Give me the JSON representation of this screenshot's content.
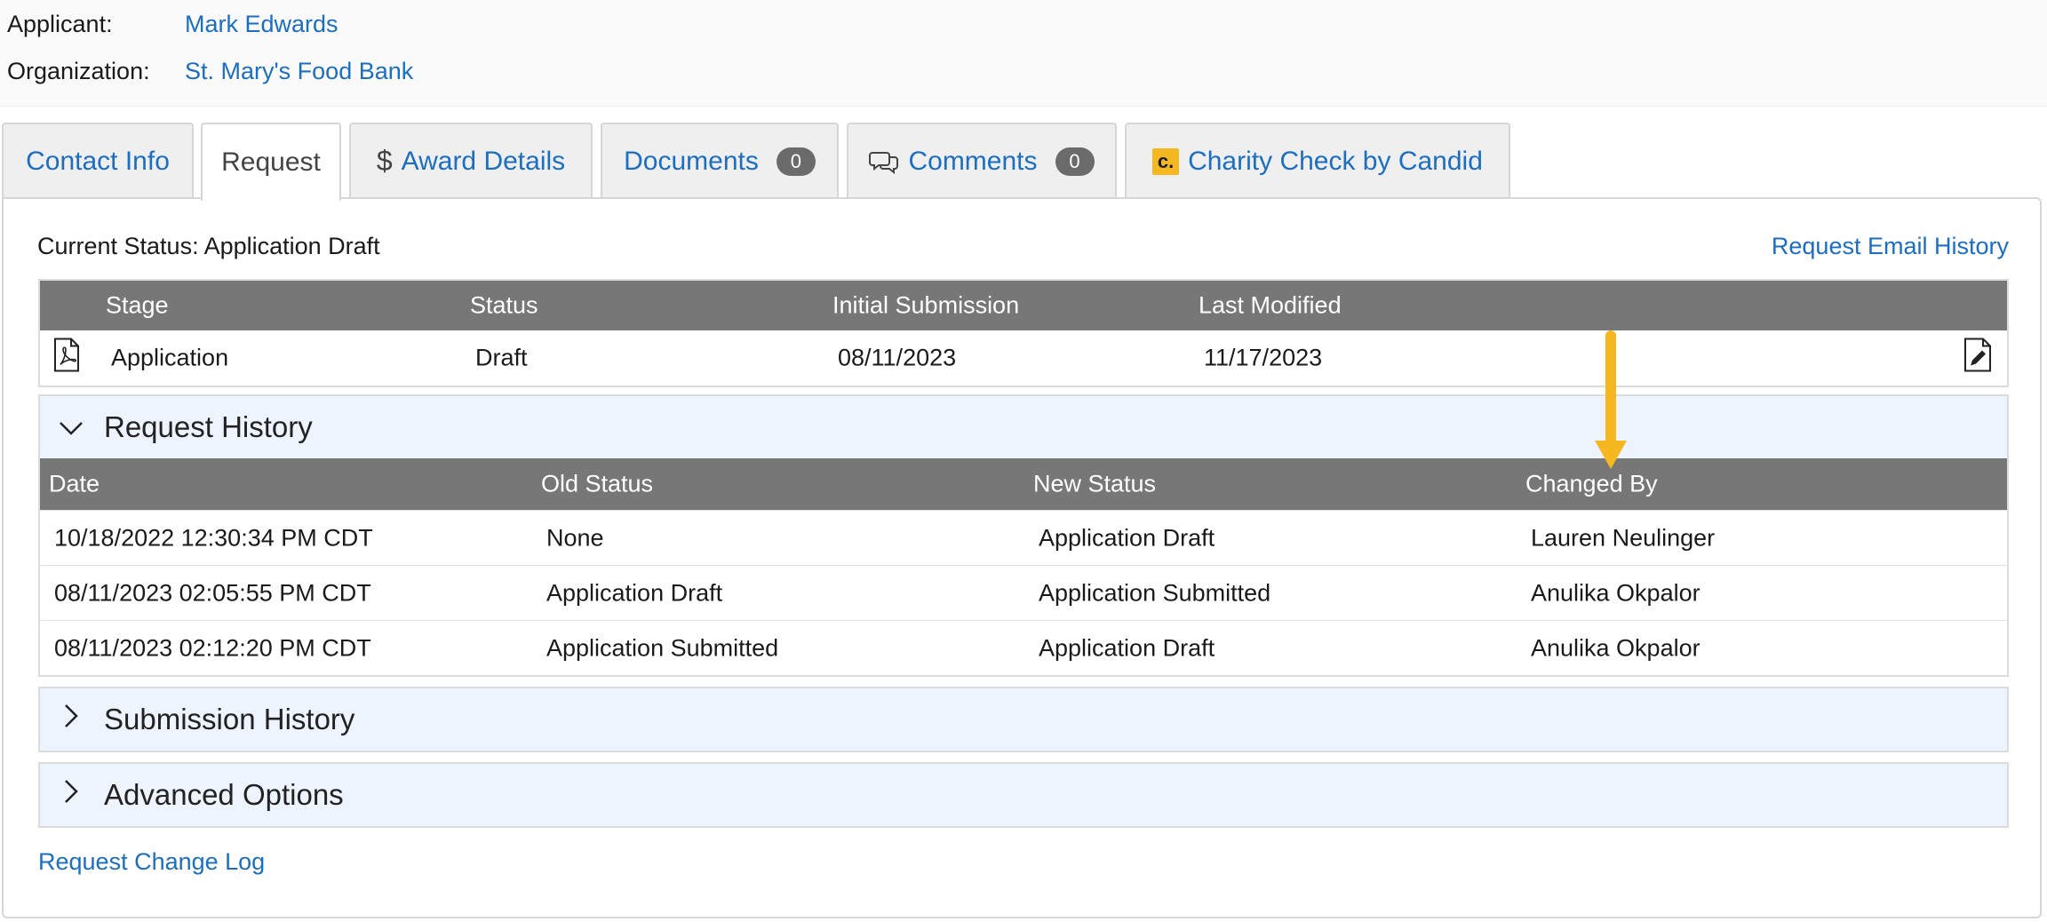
{
  "header": {
    "applicant_label": "Applicant:",
    "applicant_name": "Mark Edwards",
    "organization_label": "Organization:",
    "organization_name": "St. Mary's Food Bank"
  },
  "tabs": [
    {
      "label": "Contact Info",
      "active": false
    },
    {
      "label": "Request",
      "active": true
    },
    {
      "label": "Award Details",
      "icon": "dollar-icon",
      "active": false
    },
    {
      "label": "Documents",
      "badge": "0",
      "active": false
    },
    {
      "label": "Comments",
      "icon": "comments-icon",
      "badge": "0",
      "active": false
    },
    {
      "label": "Charity Check by Candid",
      "icon": "candid-logo-icon",
      "logo_text": "c.",
      "active": false
    }
  ],
  "request": {
    "current_status_label": "Current Status: Application Draft",
    "email_history_link": "Request Email History",
    "stage_table": {
      "headers": [
        "Stage",
        "Status",
        "Initial Submission",
        "Last Modified"
      ],
      "rows": [
        {
          "icon": "pdf-icon",
          "stage": "Application",
          "status": "Draft",
          "initial_submission": "08/11/2023",
          "last_modified": "11/17/2023",
          "action_icon": "edit-document-icon"
        }
      ]
    },
    "history": {
      "title": "Request History",
      "expanded": true,
      "headers": [
        "Date",
        "Old Status",
        "New Status",
        "Changed By"
      ],
      "rows": [
        {
          "date": "10/18/2022 12:30:34 PM CDT",
          "old_status": "None",
          "new_status": "Application Draft",
          "changed_by": "Lauren Neulinger"
        },
        {
          "date": "08/11/2023 02:05:55 PM CDT",
          "old_status": "Application Draft",
          "new_status": "Application Submitted",
          "changed_by": "Anulika Okpalor"
        },
        {
          "date": "08/11/2023 02:12:20 PM CDT",
          "old_status": "Application Submitted",
          "new_status": "Application Draft",
          "changed_by": "Anulika Okpalor"
        }
      ]
    },
    "submission_history_title": "Submission History",
    "advanced_options_title": "Advanced Options",
    "change_log_link": "Request Change Log"
  },
  "colors": {
    "link": "#1b6ec2",
    "table_header": "#777777",
    "accordion_bg": "#eef4fd",
    "badge": "#6b6b6b",
    "annotation_arrow": "#f5b820",
    "candid_logo": "#f5b820"
  }
}
